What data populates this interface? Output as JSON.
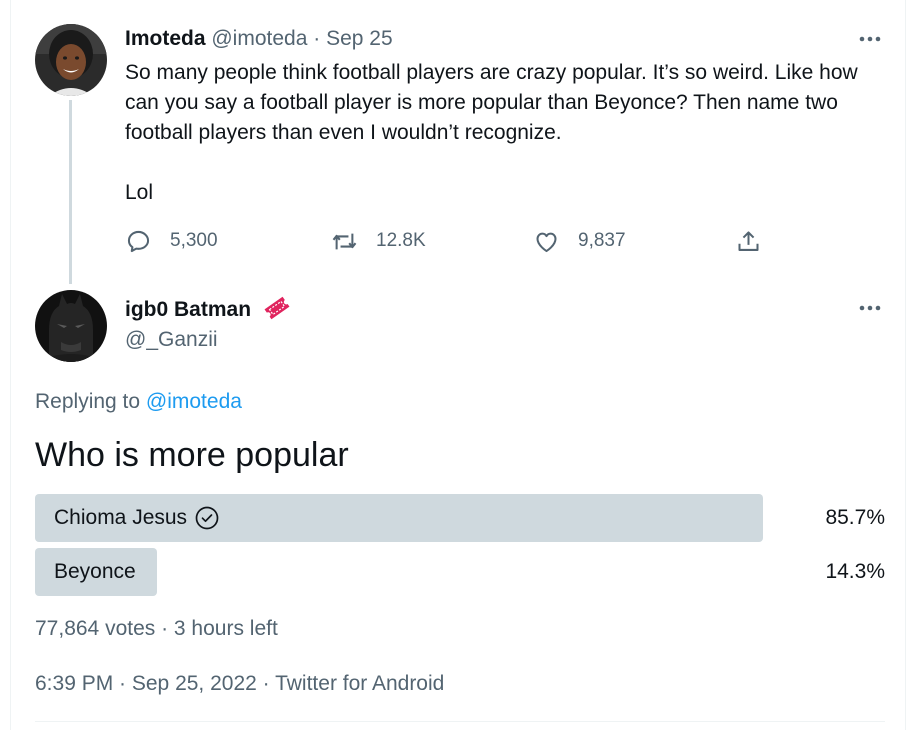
{
  "tweet": {
    "author_name": "Imoteda",
    "author_handle": "@imoteda",
    "separator": "·",
    "date": "Sep 25",
    "text_line1": "So many people think football players are crazy popular. It’s so weird. Like how can you say a football player is more popular than Beyonce? Then name two football players than even I wouldn’t recognize.",
    "text_line2": "Lol",
    "reply_count": "5,300",
    "retweet_count": "12.8K",
    "like_count": "9,837"
  },
  "reply": {
    "author_name": "igb0 Batman",
    "author_handle": "@_Ganzii",
    "replying_prefix": "Replying to",
    "replying_handle": "@imoteda",
    "question": "Who is more popular",
    "poll": [
      {
        "label": "Chioma Jesus",
        "percent": "85.7%",
        "fraction": 0.857,
        "selected": true
      },
      {
        "label": "Beyonce",
        "percent": "14.3%",
        "fraction": 0.143,
        "selected": false
      }
    ],
    "poll_summary": "77,864 votes · 3 hours left",
    "timestamp": "6:39 PM · Sep 25, 2022 · Twitter for Android"
  },
  "colors": {
    "text_primary": "#0f1419",
    "text_secondary": "#536471",
    "link": "#1d9bf0",
    "poll_bar": "#cfd9de",
    "badge": "#e0245e"
  },
  "icons": {
    "reply": "reply-icon",
    "retweet": "retweet-icon",
    "like": "heart-icon",
    "share": "share-icon",
    "more": "more-icon",
    "badge": "ticket-badge-icon",
    "check": "check-circle-icon"
  }
}
